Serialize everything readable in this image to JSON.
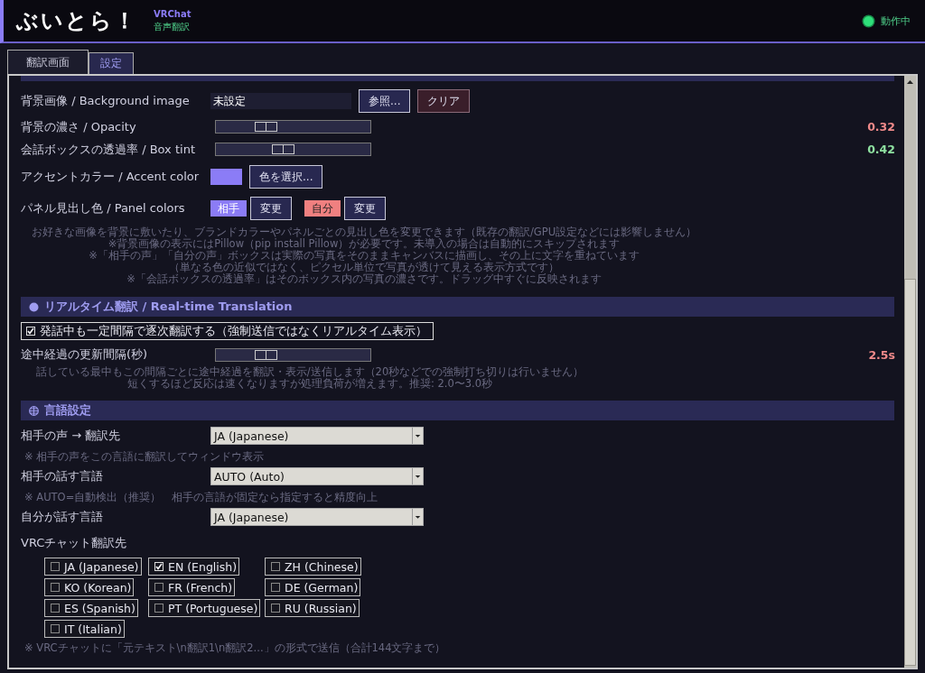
{
  "header": {
    "title": "ぶいとら！",
    "subtitle_top": "VRChat",
    "subtitle_bottom": "音声翻訳",
    "status": {
      "label": "動作中",
      "on": true
    }
  },
  "tabs": [
    {
      "label": "翻訳画面",
      "selected": false
    },
    {
      "label": "設定",
      "selected": true
    }
  ],
  "customization": {
    "image": {
      "label": "背景画像 / Background image",
      "value": "未設定",
      "browse_button": "参照...",
      "clear_button": "クリア"
    },
    "sliders": [
      {
        "label": "背景の濃さ / Opacity",
        "level": 0.32,
        "reading": "0.32",
        "color": "#f08a8a"
      },
      {
        "label": "会話ボックスの透過率 / Box tint",
        "level": 0.43,
        "reading": "0.42",
        "color": "#8ee0a0"
      }
    ],
    "accent": {
      "label": "アクセントカラー / Accent color",
      "color": "#8b7cf6",
      "button": "色を選択..."
    },
    "panel_colors": {
      "label": "パネル見出し色 / Panel colors",
      "chips": [
        {
          "text": "相手",
          "color": "#8b7cf6",
          "button": "変更"
        },
        {
          "text": "自分",
          "color": "#f08080",
          "button": "変更"
        }
      ]
    },
    "notes": [
      "お好きな画像を背景に敷いたり、ブランドカラーやパネルごとの見出し色を変更できます（既存の翻訳/GPU設定などには影響しません）",
      "※背景画像の表示にはPillow（pip install Pillow）が必要です。未導入の場合は自動的にスキップされます",
      "※「相手の声」「自分の声」ボックスは実際の写真をそのままキャンバスに描画し、その上に文字を重ねています",
      "（単なる色の近似ではなく、ピクセル単位で写真が透けて見える表示方式です）",
      "※「会話ボックスの透過率」はそのボックス内の写真の濃さです。ドラッグ中すぐに反映されます"
    ]
  },
  "realtime": {
    "title": "リアルタイム翻訳 / Real-time Translation",
    "checkbox": {
      "label": "発話中も一定間隔で逐次翻訳する（強制送信ではなくリアルタイム表示）",
      "checked": true
    },
    "slider": {
      "label": "途中経過の更新間隔(秒)",
      "level": 0.32,
      "reading": "2.5s",
      "color": "#f08a8a"
    },
    "notes": [
      "話している最中もこの間隔ごとに途中経過を翻訳・表示/送信します（20秒などでの強制打ち切りは行いません）",
      "短くするほど反応は速くなりますが処理負荷が増えます。推奨: 2.0〜3.0秒"
    ]
  },
  "language": {
    "title": "言語設定",
    "selects": [
      {
        "label": "相手の声 → 翻訳先",
        "value": "JA (Japanese)",
        "note": "※ 相手の声をこの言語に翻訳してウィンドウ表示"
      },
      {
        "label": "相手の話す言語",
        "value": "AUTO (Auto)",
        "note": "※ AUTO=自動検出（推奨）　相手の言語が固定なら指定すると精度向上"
      },
      {
        "label": "自分が話す言語",
        "value": "JA (Japanese)"
      }
    ],
    "vrc": {
      "label": "VRCチャット翻訳先",
      "options": [
        {
          "label": "JA (Japanese)",
          "checked": false
        },
        {
          "label": "EN (English)",
          "checked": true
        },
        {
          "label": "ZH (Chinese)",
          "checked": false
        },
        {
          "label": "KO (Korean)",
          "checked": false
        },
        {
          "label": "FR (French)",
          "checked": false
        },
        {
          "label": "DE (German)",
          "checked": false
        },
        {
          "label": "ES (Spanish)",
          "checked": false
        },
        {
          "label": "PT (Portuguese)",
          "checked": false
        },
        {
          "label": "RU (Russian)",
          "checked": false
        },
        {
          "label": "IT (Italian)",
          "checked": false
        }
      ],
      "note": "※ VRCチャットに「元テキスト\\n翻訳1\\n翻訳2...」の形式で送信（合計144文字まで）"
    }
  }
}
